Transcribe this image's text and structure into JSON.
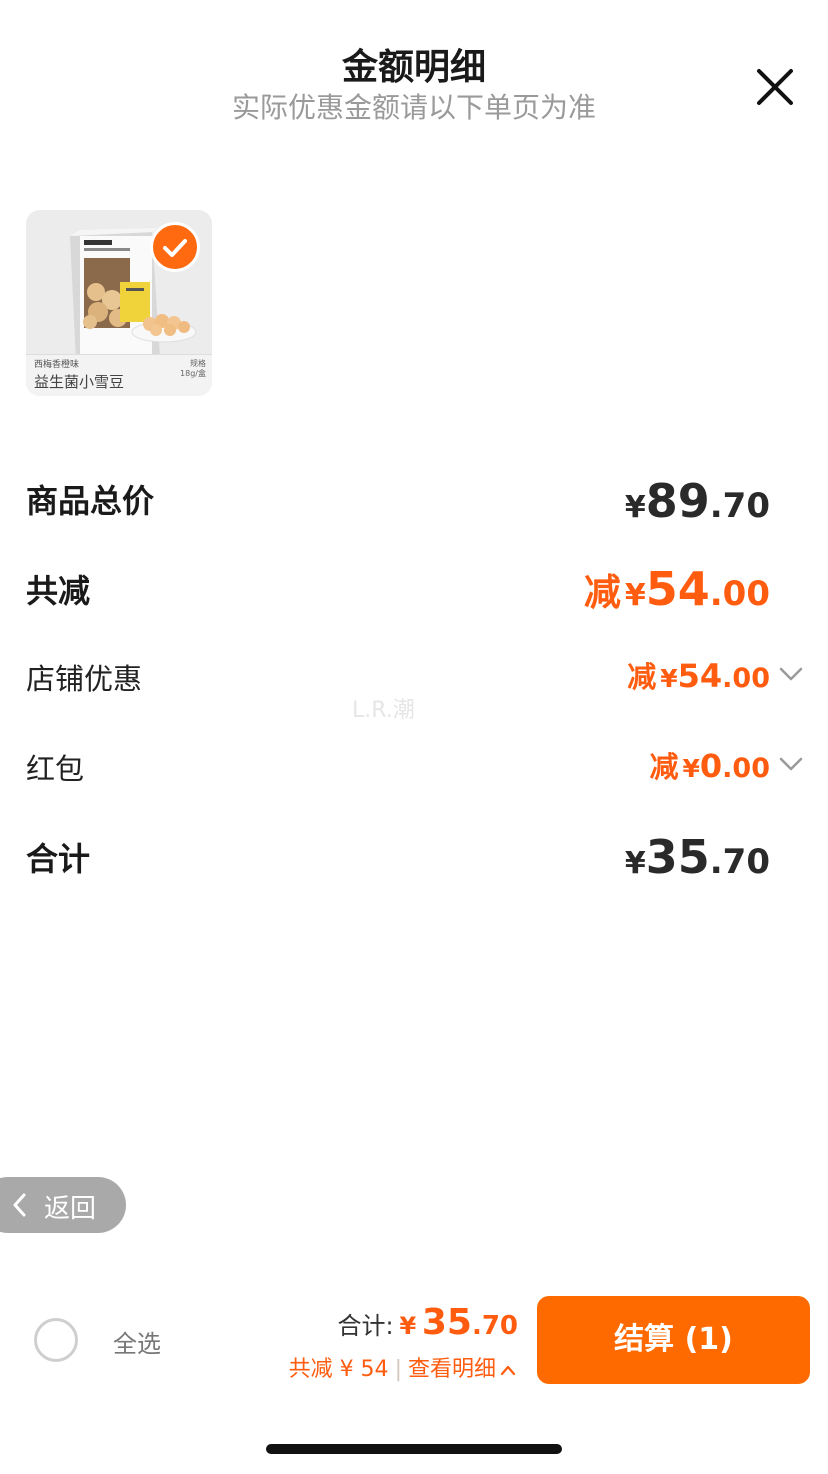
{
  "header": {
    "title": "金额明细",
    "subtitle": "实际优惠金额请以下单页为准"
  },
  "product": {
    "flavor": "西梅香橙味",
    "name": "益生菌小雪豆",
    "spec_label": "规格",
    "spec_value": "18g/盒",
    "selected": true
  },
  "summary": {
    "total": {
      "label": "商品总价",
      "currency": "¥",
      "int": "89",
      "dec": ".70"
    },
    "discount": {
      "label": "共减",
      "prefix": "减",
      "currency": "¥",
      "int": "54",
      "dec": ".00"
    },
    "store_discount": {
      "label": "店铺优惠",
      "prefix": "减",
      "currency": "¥",
      "int": "54",
      "dec": ".00"
    },
    "red_packet": {
      "label": "红包",
      "prefix": "减",
      "currency": "¥",
      "int": "0",
      "dec": ".00"
    },
    "grand_total": {
      "label": "合计",
      "currency": "¥",
      "int": "35",
      "dec": ".70"
    }
  },
  "watermark": "L.R.潮",
  "back": {
    "label": "返回"
  },
  "bottom_bar": {
    "select_all": "全选",
    "total_label": "合计:",
    "total_currency": "¥",
    "total_int": "35",
    "total_dec": ".70",
    "saved_text": "共减 ¥ 54",
    "details_link": "查看明细",
    "checkout_label": "结算 (1)"
  },
  "colors": {
    "accent": "#ff6a00",
    "discount_text": "#ff5c0f",
    "subtitle": "#9a9a9a"
  }
}
